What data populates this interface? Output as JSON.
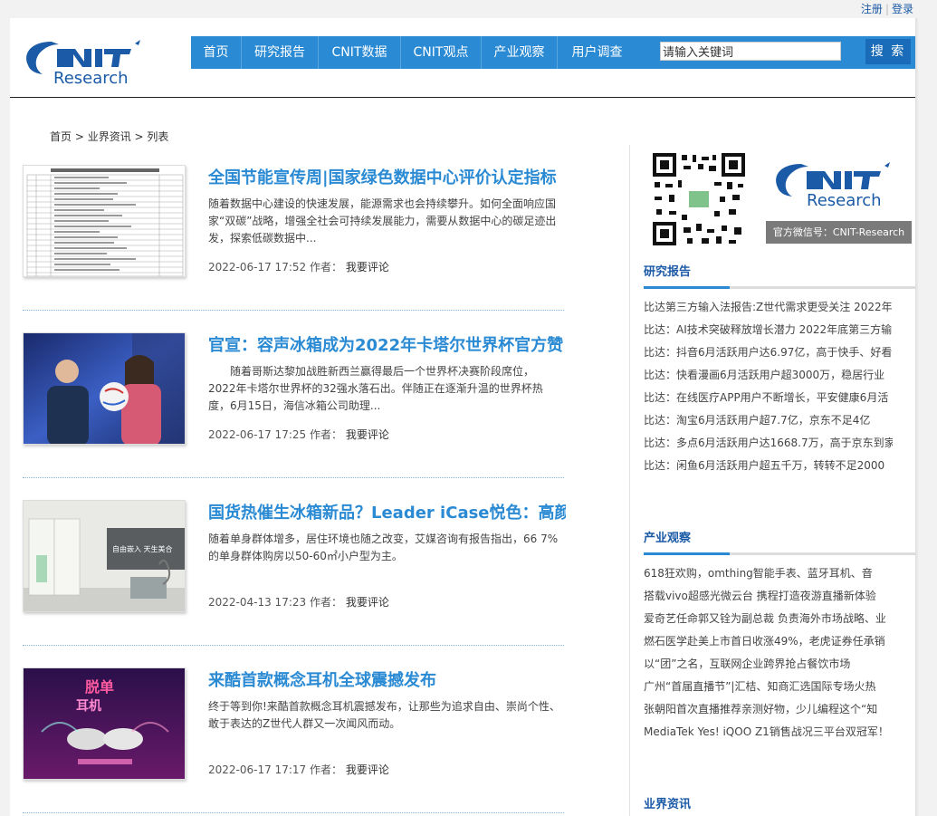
{
  "toplinks": {
    "register": "注册",
    "login": "登录"
  },
  "logo": {
    "brand": "CNIT",
    "sub": "Research"
  },
  "nav": {
    "items": [
      "首页",
      "研究报告",
      "CNIT数据",
      "CNIT观点",
      "产业观察",
      "用户调查"
    ]
  },
  "search": {
    "value": "请输入关键词",
    "button": "搜 索"
  },
  "breadcrumb": {
    "home": "首页",
    "sep1": " > ",
    "section": "业界资讯",
    "sep2": " > ",
    "current": "列表"
  },
  "articles": [
    {
      "title": "全国节能宣传周|国家绿色数据中心评价认定指标",
      "summary": "随着数据中心建设的快速发展，能源需求也会持续攀升。如何全面响应国家“双碳”战略，增强全社会可持续发展能力，需要从数据中心的碳足迹出发，探索低碳数据中...",
      "date": "2022-06-17 17:52",
      "author_label": "作者：",
      "comment": "我要评论"
    },
    {
      "title": "官宣：容声冰箱成为2022年卡塔尔世界杯官方赞",
      "summary": "　　随着哥斯达黎加战胜新西兰赢得最后一个世界杯决赛阶段席位，2022年卡塔尔世界杯的32强水落石出。伴随正在逐渐升温的世界杯热度，6月15日，海信冰箱公司助理...",
      "date": "2022-06-17 17:25",
      "author_label": "作者：",
      "comment": "我要评论"
    },
    {
      "title": "国货热催生冰箱新品？Leader iCase悦色：高颜",
      "summary": "随着单身群体增多，居住环境也随之改变，艾媒咨询有报告指出，66 7%的单身群体购房以50-60㎡小户型为主。",
      "date": "2022-04-13 17:23",
      "author_label": "作者：",
      "comment": "我要评论"
    },
    {
      "title": "来酷首款概念耳机全球震撼发布",
      "summary": "终于等到你!来酷首款概念耳机震撼发布，让那些为追求自由、崇尚个性、敢于表达的Z世代人群又一次闻风而动。",
      "date": "2022-06-17 17:17",
      "author_label": "作者：",
      "comment": "我要评论"
    }
  ],
  "thumbs": {
    "a2_text": "",
    "a3_text": "自由嵌入 天生美合",
    "a4_line1": "脱单",
    "a4_line2": "耳机"
  },
  "sidebar": {
    "wechat_label": "官方微信号：CNIT-Research",
    "reports": {
      "heading": "研究报告",
      "items": [
        "比达第三方输入法报告:Z世代需求更受关注 2022年",
        "比达：AI技术突破释放增长潜力 2022年底第三方输",
        "比达：抖音6月活跃用户达6.97亿，高于快手、好看",
        "比达：快看漫画6月活跃用户超3000万，稳居行业",
        "比达：在线医疗APP用户不断增长，平安健康6月活",
        "比达：淘宝6月活跃用户超7.7亿，京东不足4亿",
        "比达：多点6月活跃用户达1668.7万，高于京东到家",
        "比达：闲鱼6月活跃用户超五千万，转转不足2000"
      ]
    },
    "industry": {
      "heading": "产业观察",
      "items": [
        "618狂欢购，omthing智能手表、蓝牙耳机、音",
        "搭载vivo超感光微云台 携程打造夜游直播新体验",
        "爱奇艺任命郭又铨为副总裁 负责海外市场战略、业",
        "燃石医学赴美上市首日收涨49%，老虎证券任承销",
        "以“团”之名，互联网企业跨界抢占餐饮市场",
        "广州“首届直播节”|汇桔、知商汇选国际专场火热",
        "张朝阳首次直播推荐亲测好物，少儿编程这个“知",
        "MediaTek Yes! iQOO Z1销售战况三平台双冠军！"
      ]
    },
    "news": {
      "heading": "业界资讯"
    }
  },
  "colors": {
    "nav": "#2a8ad3",
    "link": "#1b5aa6",
    "title": "#2a8ad3"
  }
}
